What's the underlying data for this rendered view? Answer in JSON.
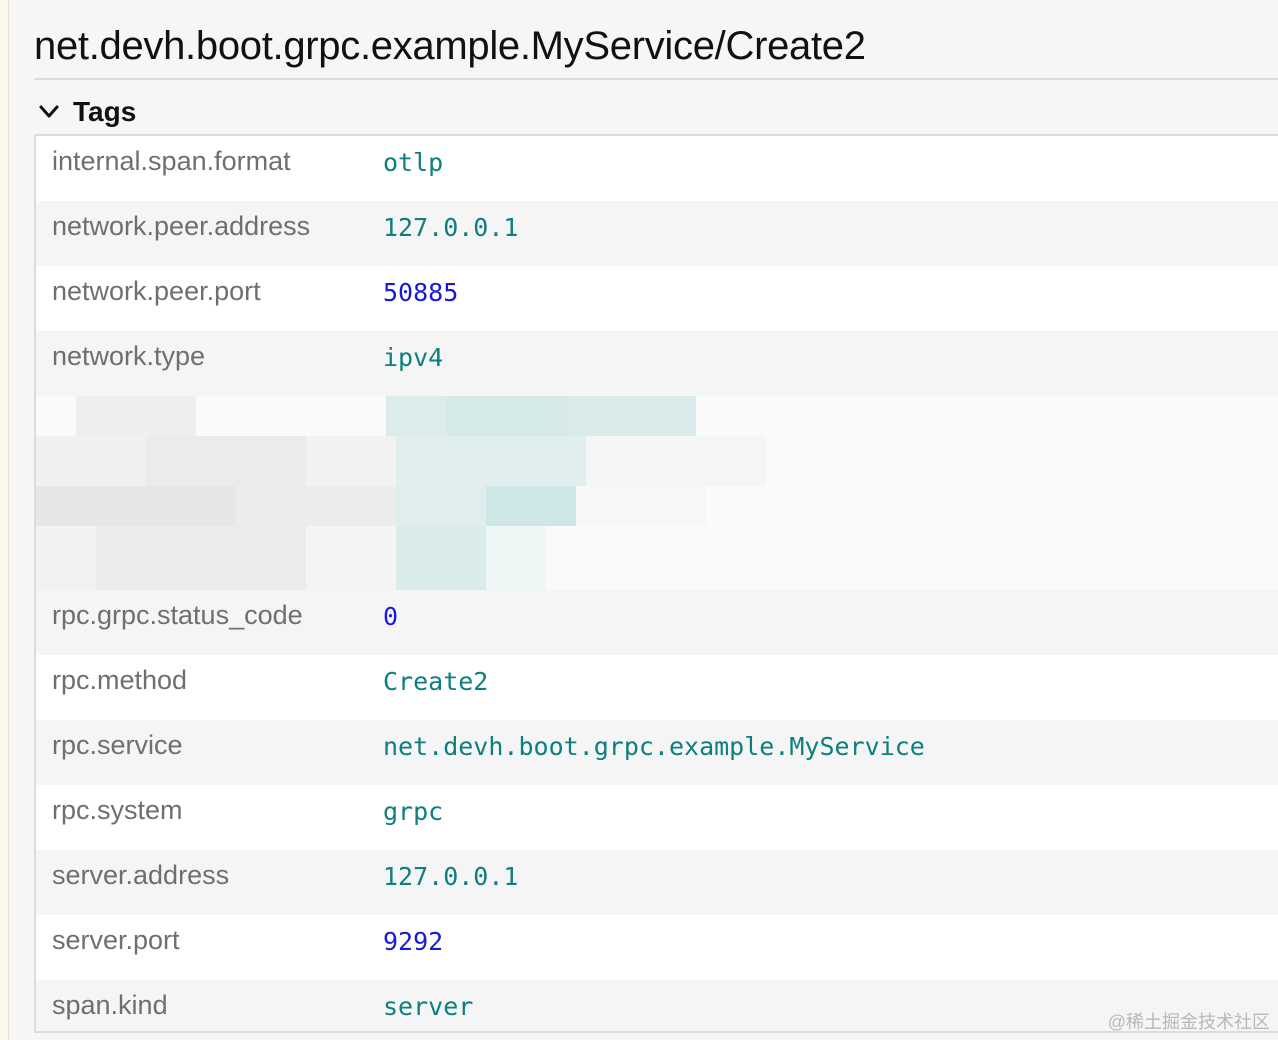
{
  "title": "net.devh.boot.grpc.example.MyService/Create2",
  "section": {
    "label": "Tags",
    "icon": "chevron-down-icon"
  },
  "tags_top": [
    {
      "key": "internal.span.format",
      "value": "otlp",
      "type": "string"
    },
    {
      "key": "network.peer.address",
      "value": "127.0.0.1",
      "type": "string"
    },
    {
      "key": "network.peer.port",
      "value": "50885",
      "type": "number"
    },
    {
      "key": "network.type",
      "value": "ipv4",
      "type": "string"
    }
  ],
  "tags_bottom": [
    {
      "key": "rpc.grpc.status_code",
      "value": "0",
      "type": "number"
    },
    {
      "key": "rpc.method",
      "value": "Create2",
      "type": "string"
    },
    {
      "key": "rpc.service",
      "value": "net.devh.boot.grpc.example.MyService",
      "type": "string"
    },
    {
      "key": "rpc.system",
      "value": "grpc",
      "type": "string"
    },
    {
      "key": "server.address",
      "value": "127.0.0.1",
      "type": "string"
    },
    {
      "key": "server.port",
      "value": "9292",
      "type": "number"
    },
    {
      "key": "span.kind",
      "value": "server",
      "type": "string"
    }
  ],
  "colors": {
    "string_value": "#0d7f7f",
    "number_value": "#1a1ad6",
    "key": "#6f6f6f"
  },
  "watermark": "@稀土掘金技术社区"
}
